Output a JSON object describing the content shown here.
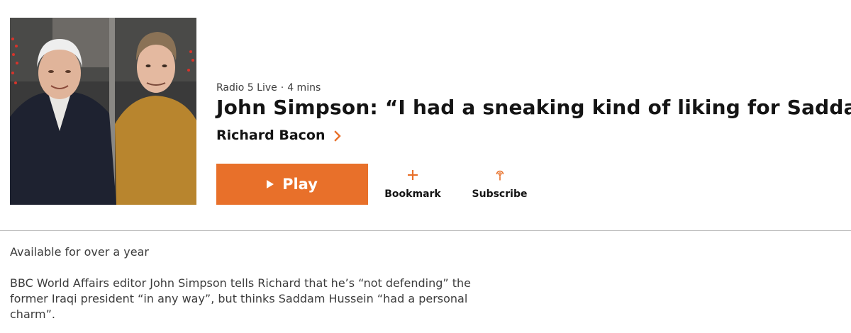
{
  "episode": {
    "network": "Radio 5 Live",
    "separator": "·",
    "duration": "4 mins",
    "title": "John Simpson: “I had a sneaking kind of liking for Saddam\"",
    "brand": "Richard Bacon",
    "play_label": "Play",
    "bookmark_label": "Bookmark",
    "subscribe_label": "Subscribe",
    "availability": "Available for over a year",
    "synopsis": "BBC World Affairs editor John Simpson tells Richard that he’s “not defending” the former Iraqi president “in any way”, but thinks Saddam Hussein “had a personal charm”."
  },
  "colors": {
    "accent": "#e8702a",
    "text": "#141414",
    "muted": "#3c3c3c",
    "divider": "#bdbdbd"
  },
  "icons": {
    "play": "play-icon",
    "bookmark": "plus-icon",
    "subscribe": "podcast-icon",
    "brand_link": "chevron-right-icon"
  }
}
